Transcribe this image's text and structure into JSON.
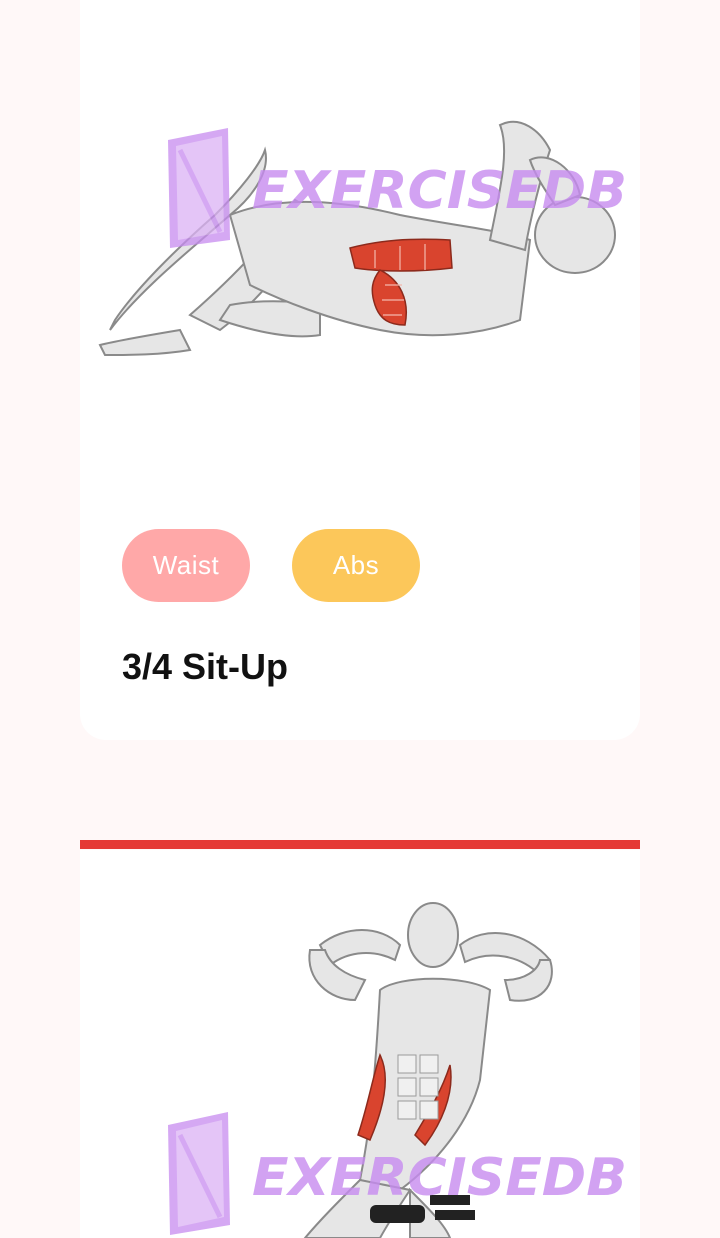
{
  "exercises": [
    {
      "name": "3/4 Sit-Up",
      "body_part": "Waist",
      "target": "Abs",
      "watermark": "EXERCISEDB"
    },
    {
      "watermark": "EXERCISEDB"
    }
  ],
  "colors": {
    "background": "#fff8f8",
    "body_part_chip": "#ffa8a8",
    "target_chip": "#fcc75a",
    "divider": "#e53935",
    "watermark": "#c78cf0",
    "muscle_highlight": "#d9442e"
  },
  "icons": {
    "watermark_logo": "exercisedb-logo-icon"
  }
}
